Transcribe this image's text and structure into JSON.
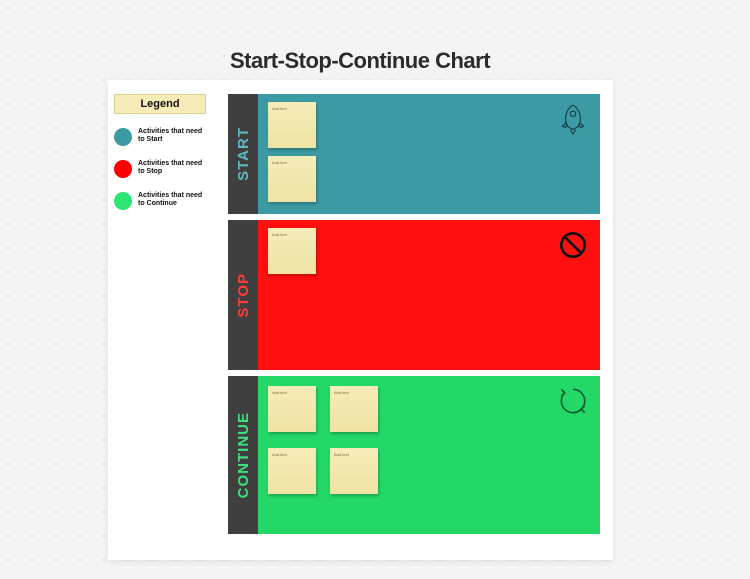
{
  "title": "Start-Stop-Continue Chart",
  "legend": {
    "header": "Legend",
    "items": [
      {
        "label": "Activities that need to Start",
        "color": "#3b9aa3"
      },
      {
        "label": "Activities that need to Stop",
        "color": "#ff0000"
      },
      {
        "label": "Activities that need to Continue",
        "color": "#2be674"
      }
    ]
  },
  "rows": {
    "start": {
      "label": "START",
      "icon": "rocket-icon",
      "notes": [
        "Add text",
        "Add text"
      ]
    },
    "stop": {
      "label": "STOP",
      "icon": "prohibited-icon",
      "notes": [
        "Add text"
      ]
    },
    "continue": {
      "label": "CONTINUE",
      "icon": "cycle-icon",
      "notes": [
        "Add text",
        "Add text",
        "Add text",
        "Add text"
      ]
    }
  }
}
